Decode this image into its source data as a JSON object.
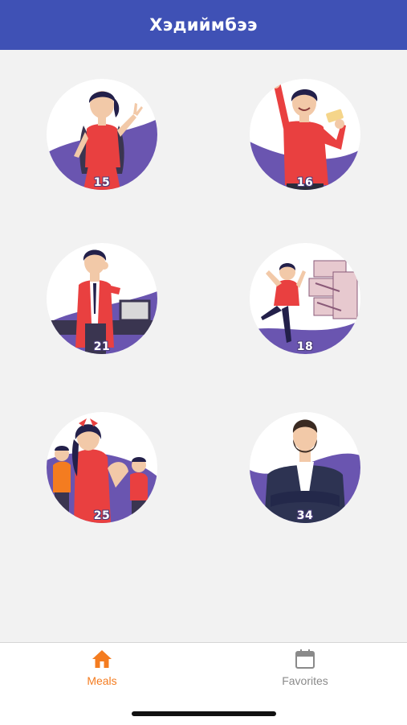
{
  "header": {
    "title": "Хэдиймбээ"
  },
  "age_groups": [
    {
      "label": "15",
      "icon": "girl-backpack-illustration"
    },
    {
      "label": "16",
      "icon": "boy-cheering-illustration"
    },
    {
      "label": "21",
      "icon": "young-man-phone-illustration"
    },
    {
      "label": "18",
      "icon": "teen-jumping-illustration"
    },
    {
      "label": "25",
      "icon": "mother-with-kids-illustration"
    },
    {
      "label": "34",
      "icon": "bearded-man-suit-illustration"
    }
  ],
  "bottom_nav": {
    "items": [
      {
        "label": "Meals",
        "icon": "home-icon",
        "active": true
      },
      {
        "label": "Favorites",
        "icon": "calendar-icon",
        "active": false
      }
    ]
  },
  "colors": {
    "header": "#3f51b5",
    "accent_purple": "#6a55b0",
    "nav_active": "#f47c20",
    "nav_inactive": "#8a8a8a",
    "background": "#f2f2f2"
  }
}
